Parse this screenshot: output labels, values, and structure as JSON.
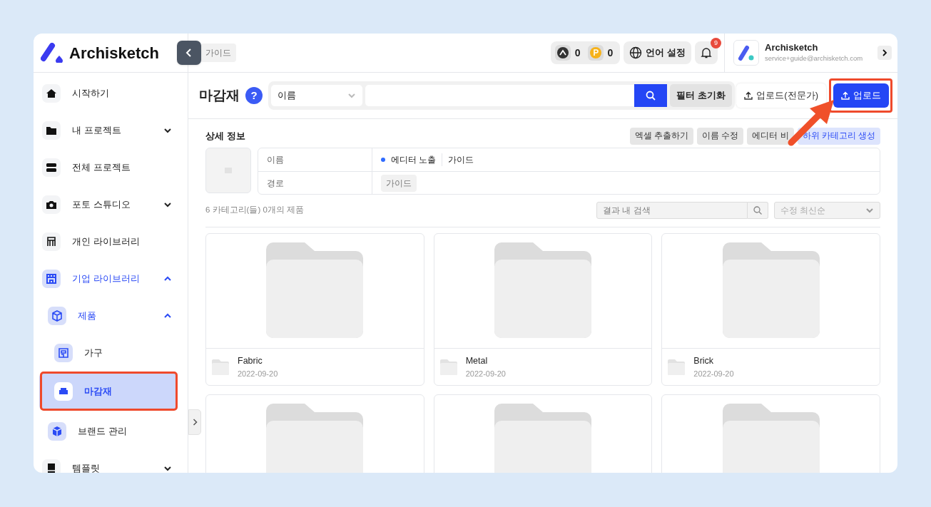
{
  "brand": {
    "name": "Archisketch"
  },
  "header": {
    "breadcrumb": "가이드",
    "counters": [
      {
        "kind": "stone",
        "value": "0"
      },
      {
        "kind": "point",
        "value": "0"
      }
    ],
    "language_button": "언어 설정",
    "notifications": {
      "badge": "9"
    },
    "profile": {
      "name": "Archisketch",
      "email": "service+guide@archisketch.com"
    }
  },
  "sidebar": {
    "items": [
      {
        "label": "시작하기",
        "selected": false
      },
      {
        "label": "내 프로젝트",
        "selected": false,
        "expanded": false
      },
      {
        "label": "전체 프로젝트",
        "selected": false
      },
      {
        "label": "포토 스튜디오",
        "selected": false,
        "expanded": false
      },
      {
        "label": "개인 라이브러리",
        "selected": false
      },
      {
        "label": "기업 라이브러리",
        "selected": false,
        "expanded": true,
        "children": [
          {
            "label": "제품",
            "selected": false,
            "expanded": true,
            "children": [
              {
                "label": "가구",
                "selected": false
              },
              {
                "label": "마감재",
                "selected": true
              }
            ]
          },
          {
            "label": "브랜드 관리",
            "selected": false
          }
        ]
      },
      {
        "label": "템플릿",
        "selected": false,
        "expanded": false
      }
    ]
  },
  "toolbar": {
    "title": "마감재",
    "help": "?",
    "field_select": "이름",
    "reset_button": "필터 초기화",
    "upload_expert_button": "업로드(전문가)",
    "upload_button": "업로드"
  },
  "details": {
    "title": "상세 정보",
    "actions": [
      {
        "label": "엑셀 추출하기",
        "kind": "plain"
      },
      {
        "label": "이름 수정",
        "kind": "plain"
      },
      {
        "label": "에디터 비",
        "kind": "plain"
      },
      {
        "label": "하위 카테고리 생성",
        "kind": "primary"
      }
    ],
    "rows": [
      {
        "label": "이름",
        "kind": "status",
        "status": {
          "label": "에디터 노출",
          "color": "#2f6bff"
        },
        "value": "가이드"
      },
      {
        "label": "경로",
        "kind": "tag",
        "value": "가이드"
      }
    ]
  },
  "summary": "6 카테고리(들) 0개의 제품",
  "result_search": {
    "placeholder": "결과 내 검색"
  },
  "sort_select": "수정 최신순",
  "folders": [
    {
      "kind": "folder",
      "name": "Fabric",
      "date": "2022-09-20"
    },
    {
      "kind": "folder",
      "name": "Metal",
      "date": "2022-09-20"
    },
    {
      "kind": "folder",
      "name": "Brick",
      "date": "2022-09-20"
    },
    {
      "kind": "folder"
    },
    {
      "kind": "folder"
    },
    {
      "kind": "folder"
    }
  ]
}
